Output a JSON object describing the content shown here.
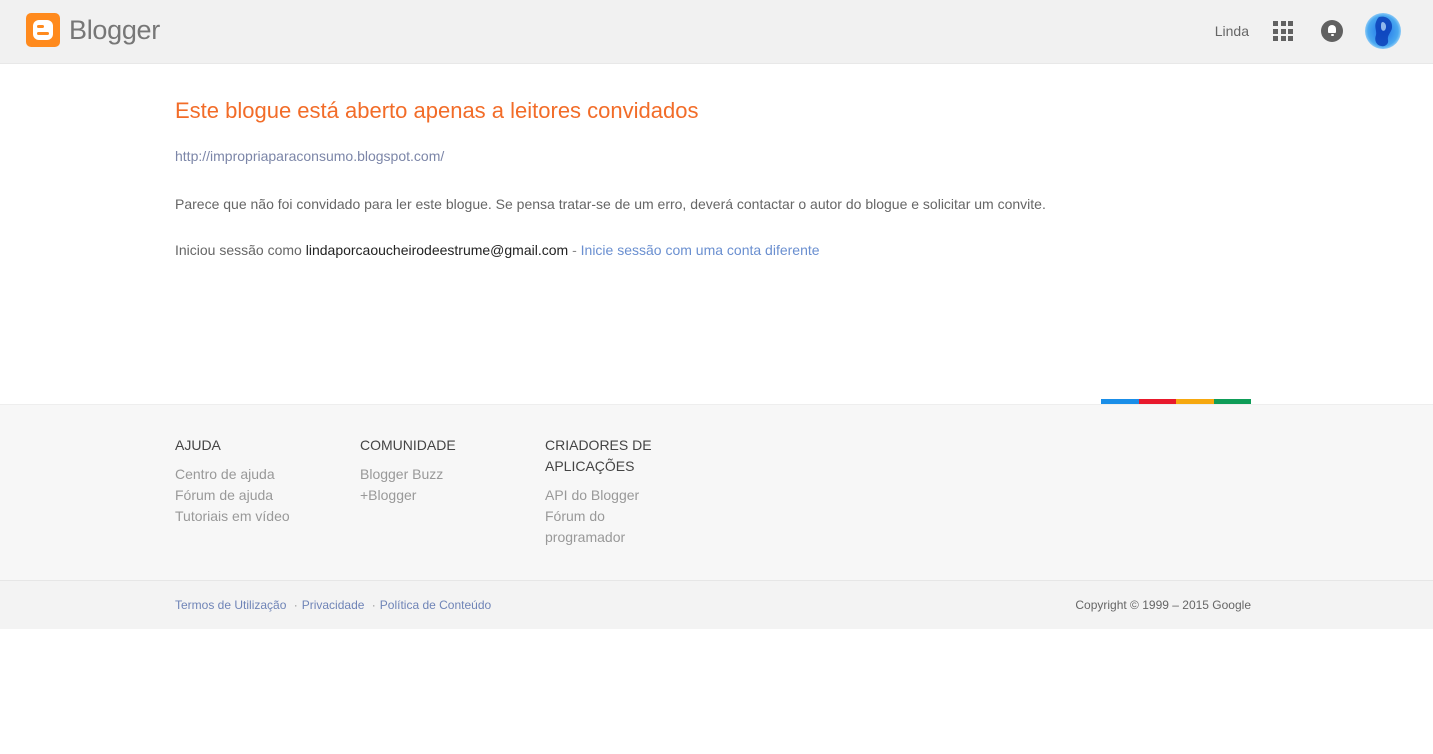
{
  "header": {
    "brand": "Blogger",
    "user_name": "Linda",
    "icons": {
      "logo": "blogger-logo-icon",
      "apps": "apps-grid-icon",
      "notifications": "bell-icon",
      "avatar": "avatar"
    },
    "brand_color": "#ff8a1d"
  },
  "main": {
    "title": "Este blogue está aberto apenas a leitores convidados",
    "blog_url": "http://impropriaparaconsumo.blogspot.com/",
    "message": "Parece que não foi convidado para ler este blogue. Se pensa tratar-se de um erro, deverá contactar o autor do blogue e solicitar um convite.",
    "signed_in_prefix": "Iniciou sessão como",
    "email": "lindaporcaoucheirodeestrume@gmail.com",
    "separator": "-",
    "switch_account": "Inicie sessão com uma conta diferente",
    "title_color": "#f26c28"
  },
  "colorbar": [
    "#1a8ee8",
    "#e8192c",
    "#f6a80f",
    "#0f9d58"
  ],
  "footer": {
    "columns": [
      {
        "heading": "AJUDA",
        "links": [
          "Centro de ajuda",
          "Fórum de ajuda",
          "Tutoriais em vídeo"
        ]
      },
      {
        "heading": "COMUNIDADE",
        "links": [
          "Blogger Buzz",
          "+Blogger"
        ]
      },
      {
        "heading": "CRIADORES DE APLICAÇÕES",
        "links": [
          "API do Blogger",
          "Fórum do programador"
        ]
      }
    ],
    "bottom_links": [
      "Termos de Utilização",
      "Privacidade",
      "Política de Conteúdo"
    ],
    "dot": "·",
    "copyright": "Copyright © 1999 – 2015 Google"
  }
}
